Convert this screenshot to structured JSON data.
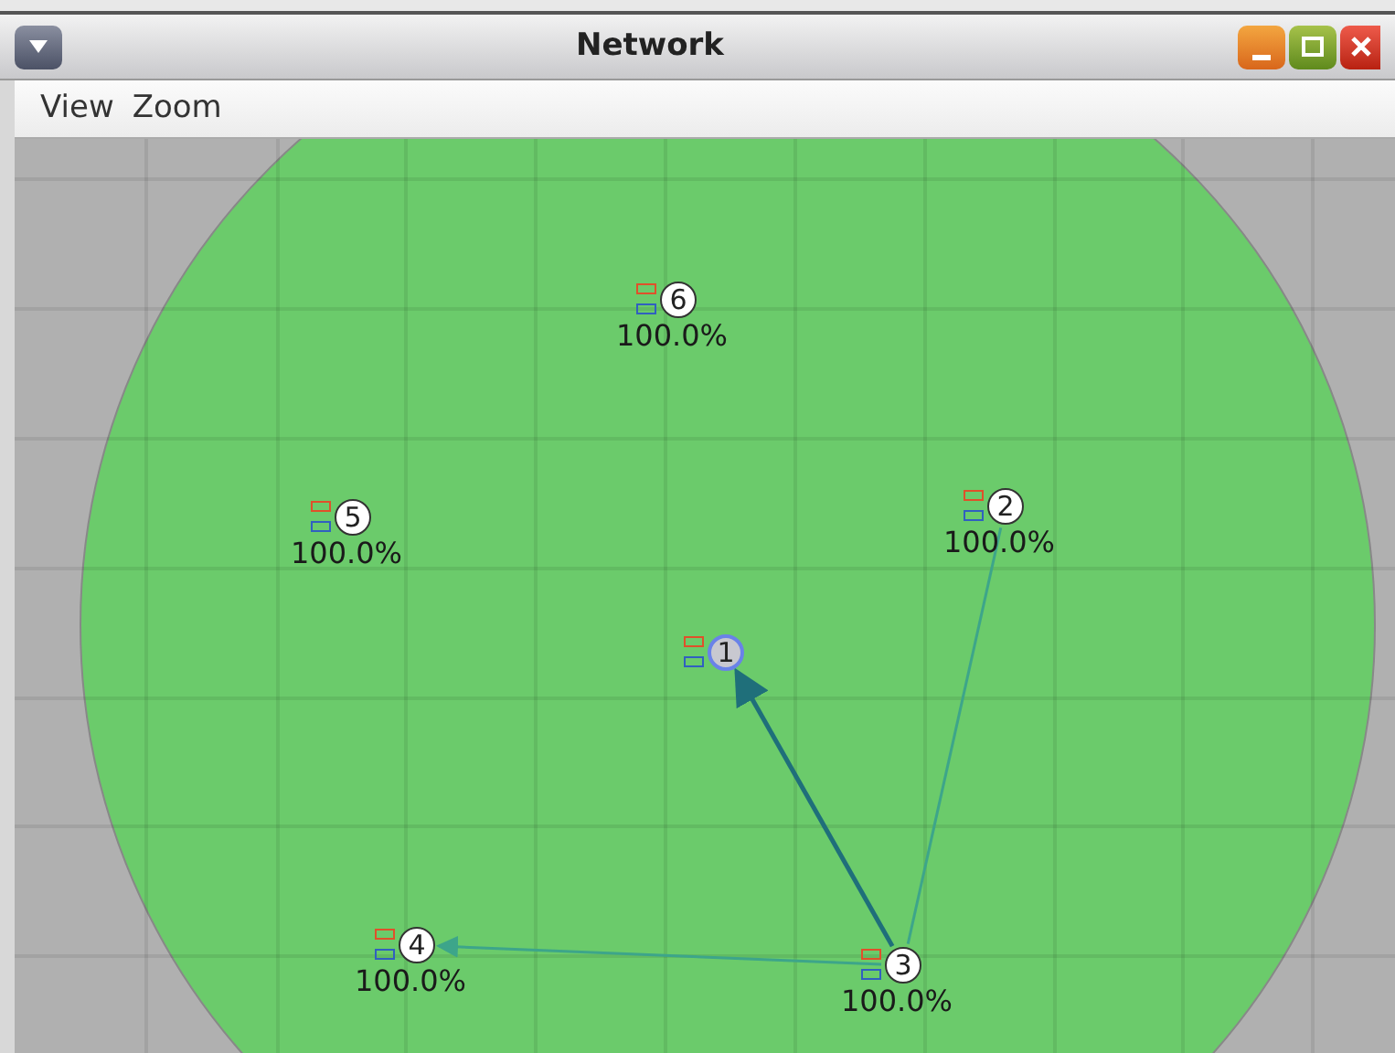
{
  "window": {
    "title": "Network"
  },
  "menu": [
    {
      "label": "View"
    },
    {
      "label": "Zoom"
    }
  ],
  "nodes": [
    {
      "label": "1",
      "selected": true
    },
    {
      "label": "2",
      "reading": "100.0%",
      "selected": false
    },
    {
      "label": "3",
      "reading": "100.0%",
      "selected": false
    },
    {
      "label": "4",
      "reading": "100.0%",
      "selected": false
    },
    {
      "label": "5",
      "reading": "100.0%",
      "selected": false
    },
    {
      "label": "6",
      "reading": "100.0%",
      "selected": false
    }
  ],
  "edges": [
    {
      "kind": "strong"
    },
    {
      "kind": "weak"
    },
    {
      "kind": "weak"
    }
  ]
}
